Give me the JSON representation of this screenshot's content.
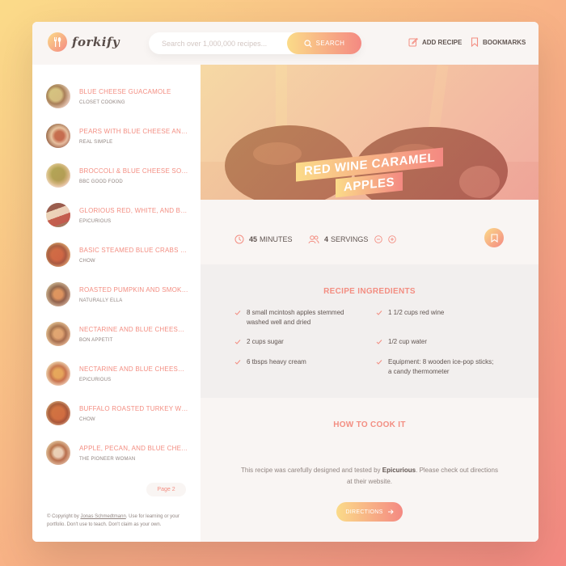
{
  "app": {
    "name": "forkify"
  },
  "search": {
    "placeholder": "Search over 1,000,000 recipes...",
    "button_label": "Search"
  },
  "nav": {
    "add_recipe": "Add recipe",
    "bookmarks": "Bookmarks"
  },
  "results": [
    {
      "title": "Blue Cheese Guacamole",
      "publisher": "Closet Cooking"
    },
    {
      "title": "Pears with Blue Cheese and ...",
      "publisher": "Real Simple"
    },
    {
      "title": "Broccoli & Blue Cheese Soup",
      "publisher": "BBC Good Food"
    },
    {
      "title": "Glorious Red, White, and Blu...",
      "publisher": "Epicurious"
    },
    {
      "title": "Basic Steamed Blue Crabs Re...",
      "publisher": "Chow"
    },
    {
      "title": "Roasted Pumpkin and Smoked...",
      "publisher": "Naturally Ella"
    },
    {
      "title": "Nectarine and Blue Cheese Sa...",
      "publisher": "Bon Appetit"
    },
    {
      "title": "Nectarine and Blue Cheese Sa...",
      "publisher": "Epicurious"
    },
    {
      "title": "Buffalo Roasted Turkey Wit...",
      "publisher": "Chow"
    },
    {
      "title": "Apple, Pecan, and Blue Chees...",
      "publisher": "The Pioneer Woman"
    }
  ],
  "pagination": {
    "next_label": "Page 2"
  },
  "copyright": {
    "prefix": "© Copyright by ",
    "author": "Jonas Schmedtmann",
    "suffix": ". Use for learning or your portfolio. Don't use to teach. Don't claim as your own."
  },
  "recipe": {
    "title_line1": "Red Wine Caramel",
    "title_line2": "Apples",
    "minutes": "45",
    "minutes_label": "minutes",
    "servings": "4",
    "servings_label": "servings",
    "ingredients_heading": "Recipe ingredients",
    "ingredients": [
      "8 small mcintosh apples stemmed washed well and dried",
      "1 1/2 cups red wine",
      "2 cups sugar",
      "1/2 cup water",
      "6 tbsps heavy cream",
      "Equipment: 8 wooden ice-pop sticks; a candy thermometer"
    ],
    "cook_heading": "How to cook it",
    "cook_text_before": "This recipe was carefully designed and tested by ",
    "cook_publisher": "Epicurious",
    "cook_text_after": ". Please check out directions at their website.",
    "directions_label": "Directions"
  },
  "colors": {
    "accent": "#f38e82",
    "grad_start": "#fbdb89",
    "grad_end": "#f48982",
    "text": "#615551",
    "muted": "#918581"
  }
}
